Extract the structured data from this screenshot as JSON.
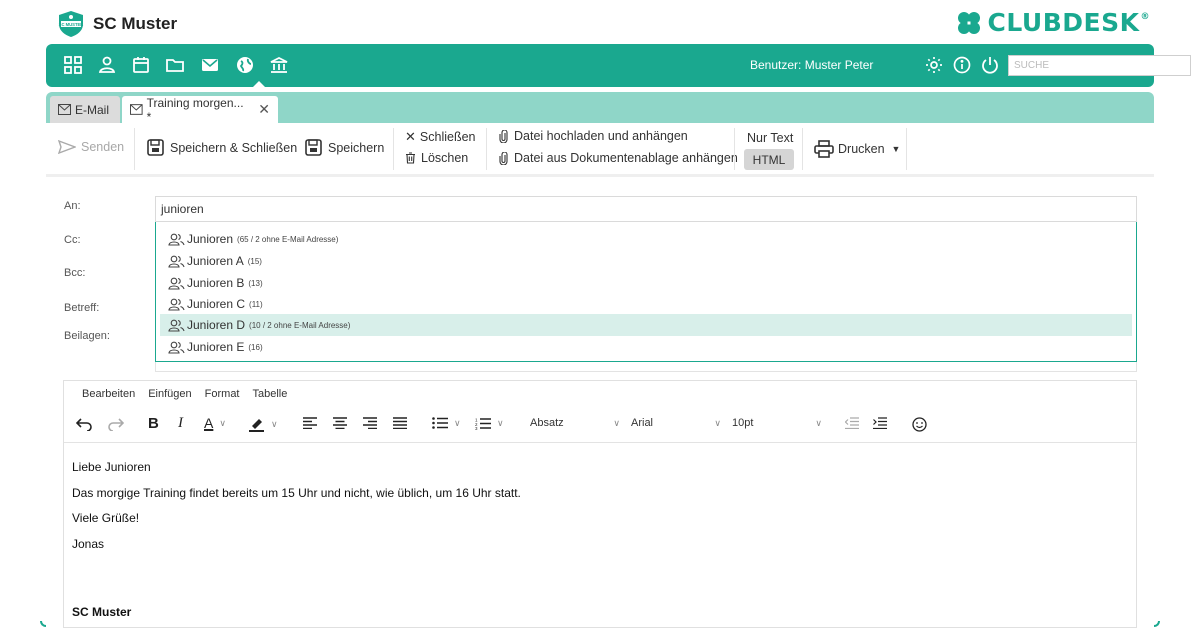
{
  "brand": {
    "name": "SC Muster",
    "logo_text": "SC MUSTER",
    "product": "CLUBDESK",
    "reg_mark": "®",
    "accent": "#1aa88f"
  },
  "navbar": {
    "icons": [
      "dashboard-icon",
      "user-icon",
      "calendar-icon",
      "folder-icon",
      "mail-icon",
      "globe-icon",
      "bank-icon"
    ],
    "active": "mail-icon",
    "user_label": "Benutzer: Muster Peter",
    "search_placeholder": "SUCHE"
  },
  "tabs": [
    {
      "label": "E-Mail"
    },
    {
      "label": "Training morgen... *"
    }
  ],
  "toolbar": {
    "send": "Senden",
    "save_close": "Speichern & Schließen",
    "save": "Speichern",
    "close": "Schließen",
    "delete": "Löschen",
    "upload": "Datei hochladen und anhängen",
    "attach_doc": "Datei aus Dokumentenablage anhängen",
    "plain_text": "Nur Text",
    "html": "HTML",
    "print": "Drucken"
  },
  "form": {
    "labels": {
      "to": "An:",
      "cc": "Cc:",
      "bcc": "Bcc:",
      "subject": "Betreff:",
      "attachments": "Beilagen:"
    },
    "to_value": "junioren"
  },
  "suggestions": [
    {
      "name": "Junioren",
      "count": "(65 / 2 ohne E-Mail Adresse)",
      "selected": false
    },
    {
      "name": "Junioren A",
      "count": "(15)",
      "selected": false
    },
    {
      "name": "Junioren B",
      "count": "(13)",
      "selected": false
    },
    {
      "name": "Junioren C",
      "count": "(11)",
      "selected": false
    },
    {
      "name": "Junioren D",
      "count": "(10 / 2 ohne E-Mail Adresse)",
      "selected": true
    },
    {
      "name": "Junioren E",
      "count": "(16)",
      "selected": false
    }
  ],
  "editor": {
    "menu": [
      "Bearbeiten",
      "Einfügen",
      "Format",
      "Tabelle"
    ],
    "block_format": "Absatz",
    "font_family": "Arial",
    "font_size": "10pt",
    "body_lines": [
      "Liebe Junioren",
      "Das morgige Training findet bereits um 15 Uhr und nicht, wie üblich, um 16 Uhr statt.",
      "Viele Grüße!",
      "Jonas"
    ],
    "signature": "SC Muster"
  }
}
